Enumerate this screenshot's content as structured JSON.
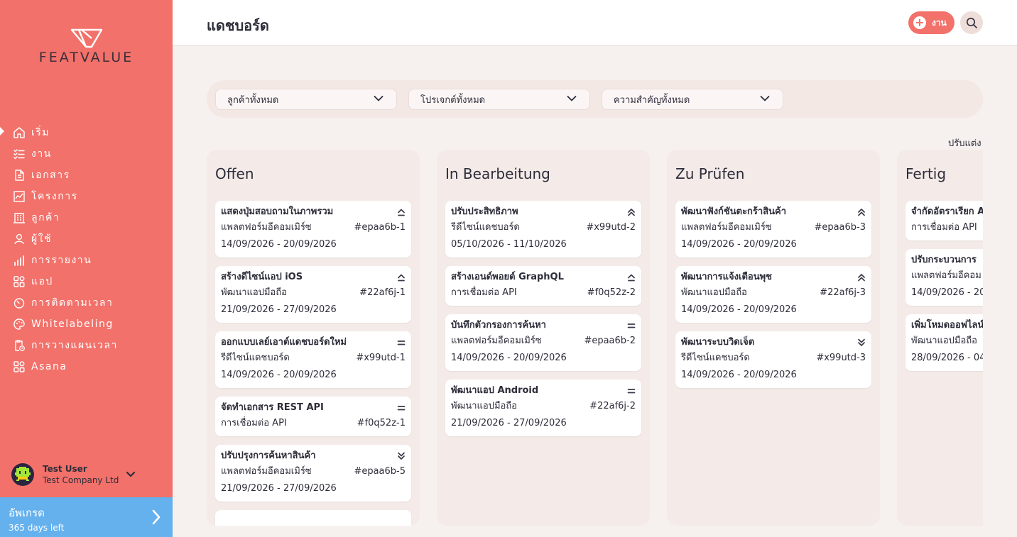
{
  "app": {
    "logo_text": "FEATVALUE",
    "brand_color": "#f2716a",
    "upgrade_color": "#64b1ee"
  },
  "sidebar": {
    "items": [
      {
        "label": "เริ่ม",
        "icon": "home-icon",
        "active": true
      },
      {
        "label": "งาน",
        "icon": "task-list-icon"
      },
      {
        "label": "เอกสาร",
        "icon": "document-icon"
      },
      {
        "label": "โครงการ",
        "icon": "chart-icon"
      },
      {
        "label": "ลูกค้า",
        "icon": "building-icon"
      },
      {
        "label": "ผู้ใช้",
        "icon": "user-icon"
      },
      {
        "label": "การรายงาน",
        "icon": "report-bars-icon"
      },
      {
        "label": "แอป",
        "icon": "apps-icon"
      },
      {
        "label": "การติดตามเวลา",
        "icon": "timer-icon"
      },
      {
        "label": "Whitelabeling",
        "icon": "palette-icon"
      },
      {
        "label": "การวางแผนเวลา",
        "icon": "clipboard-clock-icon"
      },
      {
        "label": "Asana",
        "icon": "apps-icon"
      }
    ],
    "user": {
      "name": "Test User",
      "company": "Test Company Ltd"
    },
    "upgrade": {
      "title": "อัพเกรด",
      "subtitle": "365 days left"
    }
  },
  "header": {
    "title": "แดชบอร์ด",
    "add_label": "งาน"
  },
  "filters": [
    {
      "label": "ลูกค้าทั้งหมด"
    },
    {
      "label": "โปรเจกต์ทั้งหมด"
    },
    {
      "label": "ความสำคัญทั้งหมด"
    }
  ],
  "customize_label": "ปรับแต่ง",
  "columns": [
    {
      "title": "Offen",
      "cards": [
        {
          "title": "แสดงปุ่มสอบถามในภาพรวม",
          "project": "แพลตฟอร์มอีคอมเมิร์ซ",
          "id": "#epaa6b-1",
          "dates": "14/09/2026 - 20/09/2026",
          "priority": "high"
        },
        {
          "title": "สร้างดีไซน์แอป iOS",
          "project": "พัฒนาแอปมือถือ",
          "id": "#22af6j-1",
          "dates": "21/09/2026 - 27/09/2026",
          "priority": "high"
        },
        {
          "title": "ออกแบบเลย์เอาต์แดชบอร์ดใหม่",
          "project": "รีดีไซน์แดชบอร์ด",
          "id": "#x99utd-1",
          "dates": "14/09/2026 - 20/09/2026",
          "priority": "medium"
        },
        {
          "title": "จัดทำเอกสาร REST API",
          "project": "การเชื่อมต่อ API",
          "id": "#f0q52z-1",
          "dates": "",
          "priority": "medium"
        },
        {
          "title": "ปรับปรุงการค้นหาสินค้า",
          "project": "แพลตฟอร์มอีคอมเมิร์ซ",
          "id": "#epaa6b-5",
          "dates": "21/09/2026 - 27/09/2026",
          "priority": "lowest"
        }
      ]
    },
    {
      "title": "In Bearbeitung",
      "cards": [
        {
          "title": "ปรับประสิทธิภาพ",
          "project": "รีดีไซน์แดชบอร์ด",
          "id": "#x99utd-2",
          "dates": "05/10/2026 - 11/10/2026",
          "priority": "highest"
        },
        {
          "title": "สร้างเอนด์พอยต์ GraphQL",
          "project": "การเชื่อมต่อ API",
          "id": "#f0q52z-2",
          "dates": "",
          "priority": "high"
        },
        {
          "title": "บันทึกตัวกรองการค้นหา",
          "project": "แพลตฟอร์มอีคอมเมิร์ซ",
          "id": "#epaa6b-2",
          "dates": "14/09/2026 - 20/09/2026",
          "priority": "medium"
        },
        {
          "title": "พัฒนาแอป Android",
          "project": "พัฒนาแอปมือถือ",
          "id": "#22af6j-2",
          "dates": "21/09/2026 - 27/09/2026",
          "priority": "medium"
        }
      ]
    },
    {
      "title": "Zu Prüfen",
      "cards": [
        {
          "title": "พัฒนาฟังก์ชันตะกร้าสินค้า",
          "project": "แพลตฟอร์มอีคอมเมิร์ซ",
          "id": "#epaa6b-3",
          "dates": "14/09/2026 - 20/09/2026",
          "priority": "highest"
        },
        {
          "title": "พัฒนาการแจ้งเตือนพุช",
          "project": "พัฒนาแอปมือถือ",
          "id": "#22af6j-3",
          "dates": "14/09/2026 - 20/09/2026",
          "priority": "highest"
        },
        {
          "title": "พัฒนาระบบวิดเจ็ต",
          "project": "รีดีไซน์แดชบอร์ด",
          "id": "#x99utd-3",
          "dates": "14/09/2026 - 20/09/2026",
          "priority": "lowest"
        }
      ]
    },
    {
      "title": "Fertig",
      "cards": [
        {
          "title": "จำกัดอัตราเรียก A",
          "project": "การเชื่อมต่อ API",
          "id": "",
          "dates": "",
          "priority": "none"
        },
        {
          "title": "ปรับกระบวนการ",
          "project": "แพลตฟอร์มอีคอม",
          "id": "",
          "dates": "14/09/2026 - 20/",
          "priority": "none"
        },
        {
          "title": "เพิ่มโหมดออฟไลน์",
          "project": "พัฒนาแอปมือถือ",
          "id": "",
          "dates": "28/09/2026 - 04",
          "priority": "none"
        }
      ]
    }
  ]
}
